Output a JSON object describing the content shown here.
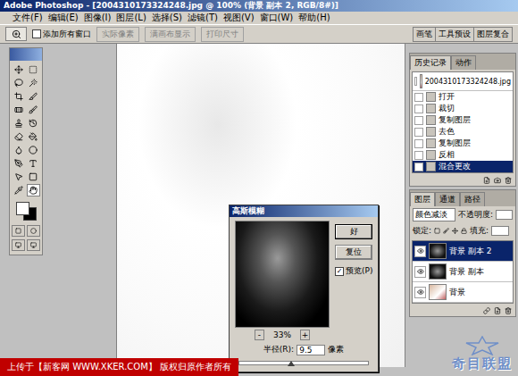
{
  "window": {
    "title": "Adobe Photoshop - [2004310173324248.jpg @ 100% (背景 副本 2, RGB/8#)]"
  },
  "menu": [
    "文件(F)",
    "编辑(E)",
    "图像(I)",
    "图层(L)",
    "选择(S)",
    "滤镜(T)",
    "视图(V)",
    "窗口(W)",
    "帮助(H)"
  ],
  "options_bar": {
    "checkbox": {
      "label": "添加所有窗口",
      "checked": false
    },
    "buttons": [
      {
        "label": "实际像素",
        "disabled": true
      },
      {
        "label": "满画布显示",
        "disabled": true
      },
      {
        "label": "打印尺寸",
        "disabled": true
      }
    ],
    "palette_tabs": [
      "画笔",
      "工具预设",
      "图层复合"
    ]
  },
  "history": {
    "tabs": [
      {
        "label": "历史记录",
        "selected": true
      },
      {
        "label": "动作",
        "selected": false
      }
    ],
    "snapshot": "2004310173324248.jpg",
    "items": [
      {
        "label": "打开",
        "selected": false
      },
      {
        "label": "裁切",
        "selected": false
      },
      {
        "label": "复制图层",
        "selected": false
      },
      {
        "label": "去色",
        "selected": false
      },
      {
        "label": "复制图层",
        "selected": false
      },
      {
        "label": "反相",
        "selected": false
      },
      {
        "label": "混合更改",
        "selected": true
      }
    ]
  },
  "layers": {
    "tabs": [
      {
        "label": "图层",
        "selected": true
      },
      {
        "label": "通道",
        "selected": false
      },
      {
        "label": "路径",
        "selected": false
      }
    ],
    "blend_mode": "颜色减淡",
    "opacity_label": "不透明度:",
    "lock_label": "锁定:",
    "fill_label": "填充:",
    "items": [
      {
        "name": "背景 副本 2",
        "selected": true,
        "visible": true
      },
      {
        "name": "背景 副本",
        "selected": false,
        "visible": true
      },
      {
        "name": "背景",
        "selected": false,
        "visible": true
      }
    ]
  },
  "dialog": {
    "title": "高斯模糊",
    "buttons": [
      "好",
      "复位"
    ],
    "preview": {
      "label": "预览(P)",
      "checked": true
    },
    "zoom": "33%",
    "zoom_out": "-",
    "zoom_in": "+",
    "radius_label": "半径(R):",
    "radius": "9.5",
    "unit": "像素",
    "level": 0.4
  },
  "banner": "上传于【新客网 WWW.XKER.COM】 版权归原作者所有",
  "watermark": "奇目联盟"
}
